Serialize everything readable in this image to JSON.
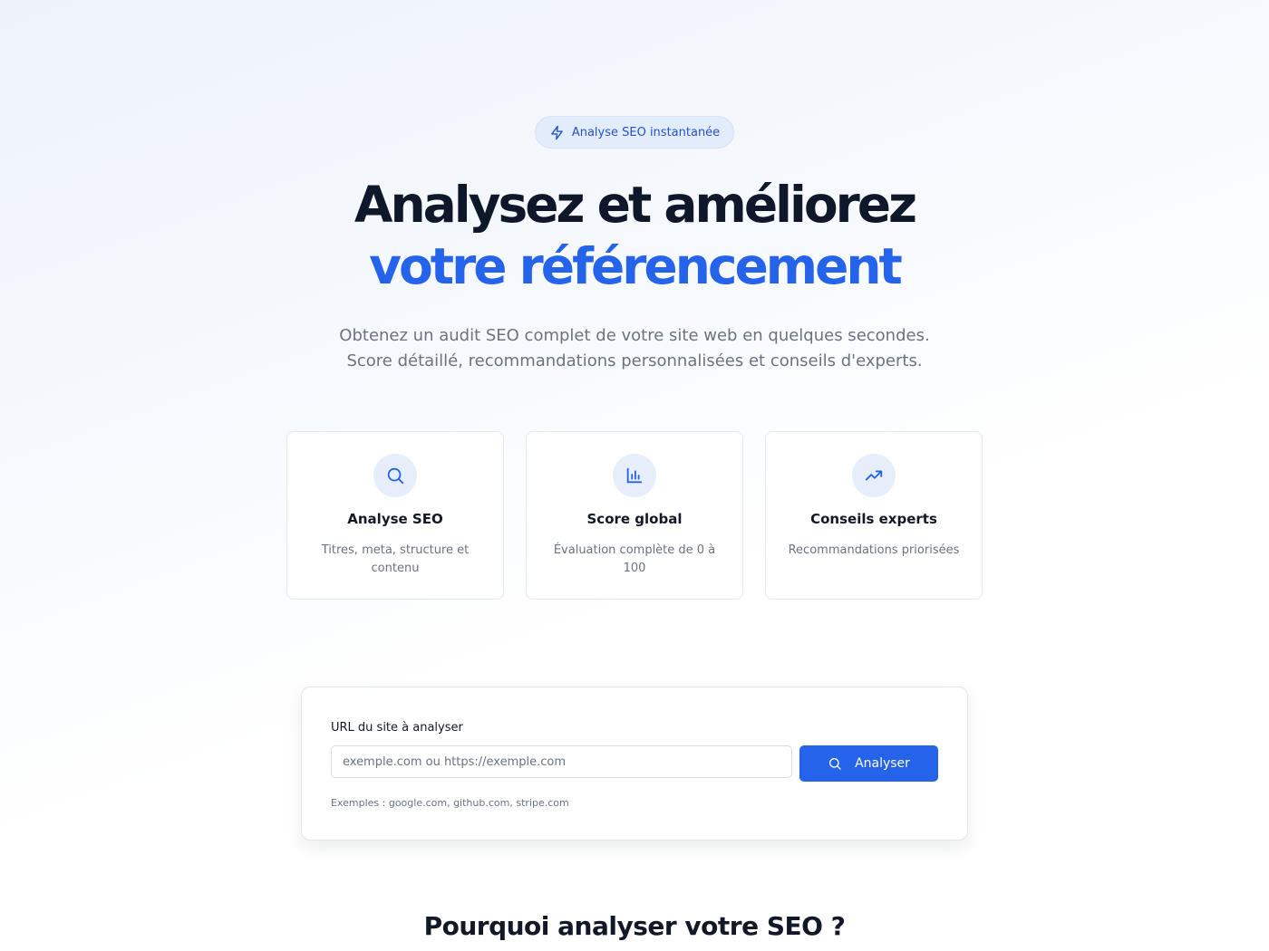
{
  "badge": {
    "icon": "lightning-icon",
    "label": "Analyse SEO instantanée"
  },
  "hero": {
    "title_line1": "Analysez et améliorez",
    "title_line2": "votre référencement",
    "subtitle_line1": "Obtenez un audit SEO complet de votre site web en quelques secondes.",
    "subtitle_line2": "Score détaillé, recommandations personnalisées et conseils d'experts."
  },
  "features": [
    {
      "icon": "search-icon",
      "title": "Analyse SEO",
      "description": "Titres, meta, structure et contenu"
    },
    {
      "icon": "bar-chart-icon",
      "title": "Score global",
      "description": "Évaluation complète de 0 à 100"
    },
    {
      "icon": "trending-up-icon",
      "title": "Conseils experts",
      "description": "Recommandations priorisées"
    }
  ],
  "form": {
    "label": "URL du site à analyser",
    "input_value": "",
    "placeholder": "exemple.com ou https://exemple.com",
    "button_label": "Analyser",
    "examples": "Exemples : google.com, github.com, stripe.com"
  },
  "section": {
    "title": "Pourquoi analyser votre SEO ?"
  },
  "colors": {
    "accent": "#2563eb",
    "badge_bg": "#e3ecfb",
    "icon_bg": "#e6eefb",
    "text_dark": "#0f172a",
    "text_muted": "#6b7280"
  }
}
